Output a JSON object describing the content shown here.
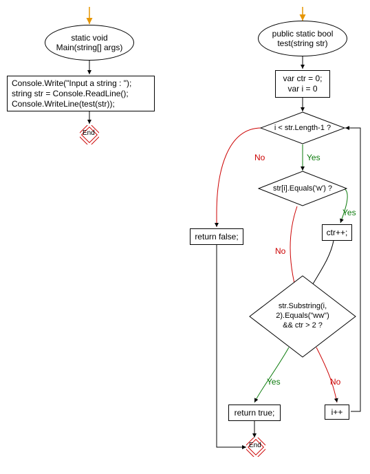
{
  "left": {
    "start": "static void\nMain(string[] args)",
    "body": "Console.Write(\"Input a string : \");\nstring str = Console.ReadLine();\nConsole.WriteLine(test(str));",
    "end": "End"
  },
  "right": {
    "start": "public static bool\ntest(string str)",
    "init": "var ctr = 0;\nvar i = 0",
    "cond1": "i < str.Length-1 ?",
    "cond2": "str[i].Equals('w') ?",
    "cond3": "str.Substring(i,\n2).Equals(\"ww\")\n&& ctr > 2 ?",
    "ctrpp": "ctr++;",
    "retFalse": "return false;",
    "retTrue": "return true;",
    "ipp": "i++",
    "end": "End"
  },
  "labels": {
    "yes": "Yes",
    "no": "No"
  }
}
